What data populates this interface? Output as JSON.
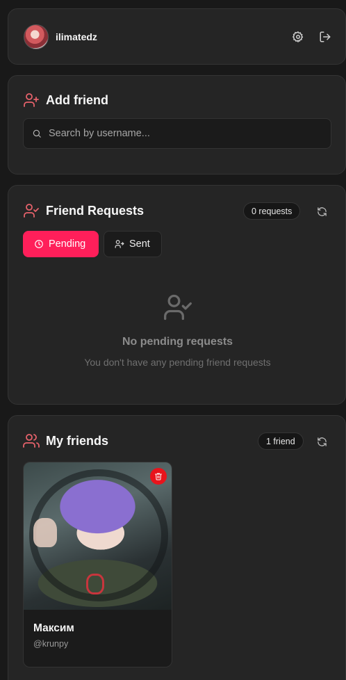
{
  "profile": {
    "username": "ilimatedz"
  },
  "add_friend": {
    "title": "Add friend",
    "search_placeholder": "Search by username..."
  },
  "friend_requests": {
    "title": "Friend Requests",
    "count_label": "0 requests",
    "tabs": [
      {
        "label": "Pending",
        "active": true
      },
      {
        "label": "Sent",
        "active": false
      }
    ],
    "empty_title": "No pending requests",
    "empty_subtitle": "You don't have any pending friend requests"
  },
  "my_friends": {
    "title": "My friends",
    "count_label": "1 friend",
    "friends": [
      {
        "name": "Максим",
        "handle": "@krunpy"
      }
    ]
  },
  "colors": {
    "accent": "#ff1f5a",
    "icon_accent": "#e8636c",
    "danger": "#e8141c",
    "background": "#191919",
    "card": "#252525"
  }
}
